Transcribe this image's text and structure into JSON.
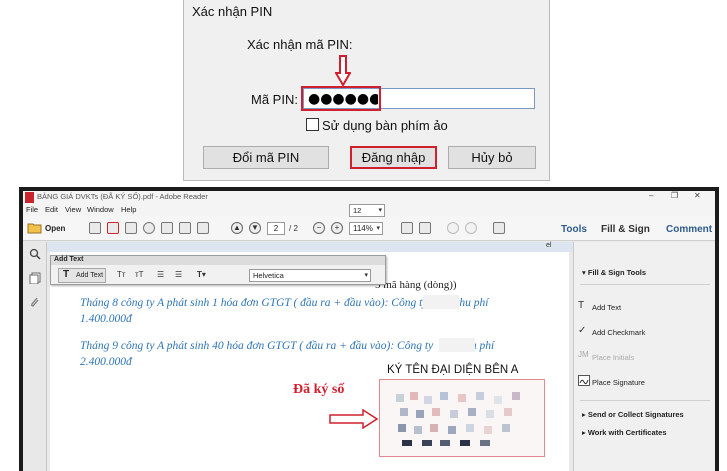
{
  "pin_dialog": {
    "title": "Xác nhận PIN",
    "heading": "Xác nhận mã PIN:",
    "pin_label": "Mã PIN:",
    "pin_value": "●●●●●●●●",
    "virtual_keyboard_label": "Sử dụng bàn phím ảo",
    "virtual_keyboard_checked": false,
    "buttons": {
      "change_pin": "Đổi mã PIN",
      "login": "Đăng nhập",
      "cancel": "Hủy bỏ"
    },
    "highlight_color": "#d0202e"
  },
  "reader": {
    "window_title": "BẢNG GIÁ DVKTs (ĐÃ KÝ SỐ).pdf - Adobe Reader",
    "window_controls": {
      "minimize": "–",
      "restore": "❐",
      "close": "✕"
    },
    "menu": [
      "File",
      "Edit",
      "View",
      "Window",
      "Help"
    ],
    "toolbar": {
      "open_label": "Open",
      "page_current": "2",
      "page_total": "/ 2",
      "zoom": "114%",
      "zoom_out": "−",
      "zoom_in": "+"
    },
    "right_tabs": [
      "Tools",
      "Fill & Sign",
      "Comment"
    ],
    "add_text_panel": {
      "title": "Add Text",
      "add_text_button": "Add Text",
      "font": "Helvetica",
      "size": "12"
    },
    "ruler_mark": "el",
    "document": {
      "partial_line": "5 mã hàng (dòng))",
      "para1_line1": "Tháng 8 công ty A phát sinh 1 hóa đơn GTGT ( đầu ra + đầu vào): Công ty",
      "para1_tail": "thu phí",
      "para1_line2": "1.400.000đ",
      "para2_line1": "Tháng 9 công ty A phát sinh 40 hóa đơn GTGT ( đầu ra + đầu vào): Công ty",
      "para2_tail": "thu phí",
      "para2_line2": "2.400.000đ",
      "signature_title": "KÝ TÊN ĐẠI DIỆN BÊN A",
      "signed_label": "Đã ký số"
    },
    "fill_sign_pane": {
      "section_title": "Fill & Sign Tools",
      "items": [
        {
          "label": "Add Text",
          "icon": "text-icon",
          "enabled": true
        },
        {
          "label": "Add Checkmark",
          "icon": "check-icon",
          "enabled": true
        },
        {
          "label": "Place Initials",
          "icon": "initials-icon",
          "enabled": false
        },
        {
          "label": "Place Signature",
          "icon": "signature-icon",
          "enabled": true
        }
      ],
      "sections": [
        "Send or Collect Signatures",
        "Work with Certificates"
      ]
    }
  }
}
